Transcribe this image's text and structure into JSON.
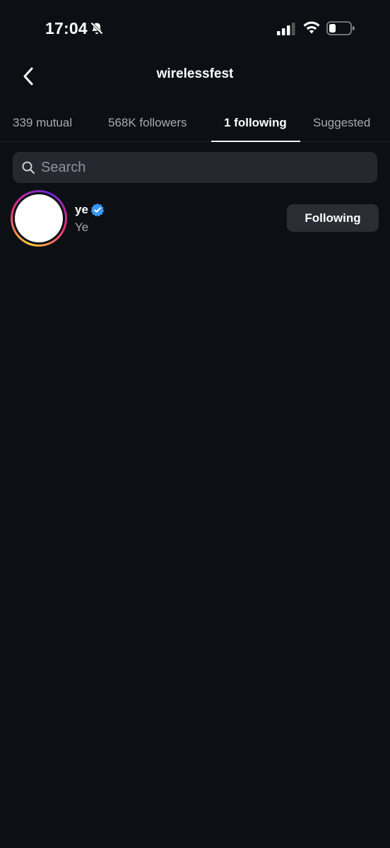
{
  "status": {
    "time": "17:04"
  },
  "header": {
    "title": "wirelessfest"
  },
  "tabs": [
    {
      "label": "339 mutual"
    },
    {
      "label": "568K followers"
    },
    {
      "label": "1 following",
      "active": true
    },
    {
      "label": "Suggested"
    }
  ],
  "search": {
    "placeholder": "Search"
  },
  "list": [
    {
      "username": "ye",
      "full_name": "Ye",
      "verified": true,
      "button_label": "Following"
    }
  ],
  "colors": {
    "background": "#0c0f14",
    "verified": "#3897f0",
    "button": "#2a2d34"
  }
}
